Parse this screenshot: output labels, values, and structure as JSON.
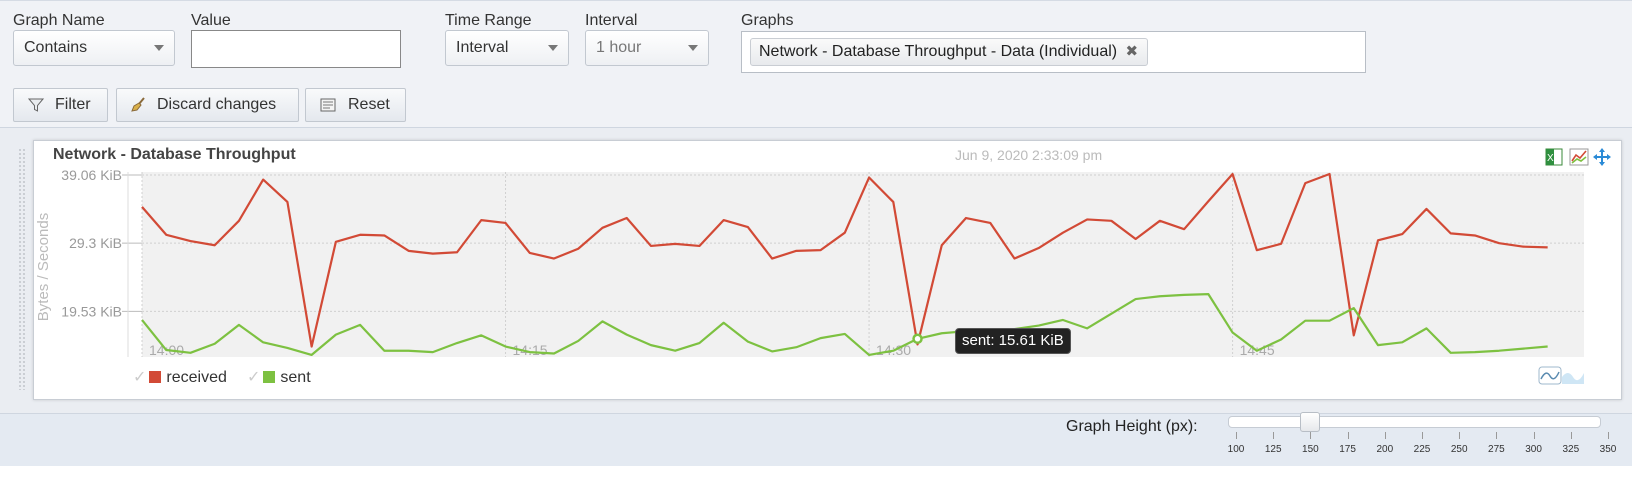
{
  "filters": {
    "graph_name_label": "Graph Name",
    "graph_name_value": "Contains",
    "value_label": "Value",
    "value_input": "",
    "time_range_label": "Time Range",
    "time_range_value": "Interval",
    "interval_label": "Interval",
    "interval_value": "1 hour",
    "graphs_label": "Graphs",
    "graphs_tag": "Network - Database Throughput - Data (Individual)"
  },
  "buttons": {
    "filter": "Filter",
    "discard": "Discard changes",
    "reset": "Reset"
  },
  "graph": {
    "title": "Network - Database Throughput",
    "date": "Jun 9, 2020 2:33:09 pm",
    "tooltip": "sent: 15.61 KiB"
  },
  "chart_data": {
    "type": "line",
    "ylabel": "Bytes / Seconds",
    "ylim": [
      13.0,
      39.06
    ],
    "yticks": [
      "39.06 KiB",
      "29.3 KiB",
      "19.53 KiB"
    ],
    "ytick_values": [
      39.06,
      29.3,
      19.53
    ],
    "xticks": [
      "14:00",
      "14:15",
      "14:30",
      "14:45"
    ],
    "xtick_minutes": [
      0,
      15,
      30,
      45
    ],
    "xlim_minutes": [
      0,
      59.5
    ],
    "grid": true,
    "legend_position": "bottom-left",
    "series": [
      {
        "name": "received",
        "color": "#d24a36",
        "values": [
          34.5,
          30.5,
          29.6,
          29.0,
          32.5,
          38.4,
          35.2,
          14.5,
          29.5,
          30.5,
          30.4,
          28.2,
          27.8,
          28.0,
          32.6,
          32.2,
          27.9,
          27.1,
          28.5,
          31.5,
          32.9,
          28.9,
          29.2,
          28.9,
          32.6,
          31.6,
          27.1,
          28.2,
          28.3,
          30.8,
          38.7,
          35.2,
          14.8,
          29.0,
          32.9,
          32.2,
          27.1,
          28.6,
          30.8,
          32.7,
          32.5,
          29.9,
          32.5,
          31.3,
          35.3,
          39.2,
          28.3,
          29.2,
          37.9,
          39.2,
          16.1,
          29.7,
          30.6,
          34.2,
          30.7,
          30.4,
          29.3,
          28.8,
          28.7
        ]
      },
      {
        "name": "sent",
        "color": "#7dc141",
        "values": [
          18.3,
          14.0,
          13.6,
          14.9,
          17.6,
          15.1,
          14.3,
          13.3,
          16.2,
          17.6,
          13.9,
          13.9,
          13.7,
          15.0,
          16.1,
          14.5,
          13.7,
          13.5,
          15.3,
          18.1,
          16.2,
          14.7,
          13.9,
          15.0,
          17.9,
          15.2,
          13.8,
          14.4,
          15.7,
          16.3,
          13.3,
          13.9,
          15.61,
          16.4,
          16.7,
          16.3,
          17.0,
          17.5,
          18.3,
          17.1,
          19.2,
          21.3,
          21.7,
          21.9,
          22.0,
          16.5,
          13.9,
          15.5,
          18.2,
          18.2,
          20.0,
          14.7,
          15.1,
          17.1,
          13.6,
          13.7,
          13.9,
          14.2,
          14.5
        ]
      }
    ]
  },
  "graph_height": {
    "label": "Graph Height (px):",
    "value": 150,
    "min": 100,
    "max": 350,
    "ticks": [
      "100",
      "125",
      "150",
      "175",
      "200",
      "225",
      "250",
      "275",
      "300",
      "325",
      "350"
    ]
  }
}
